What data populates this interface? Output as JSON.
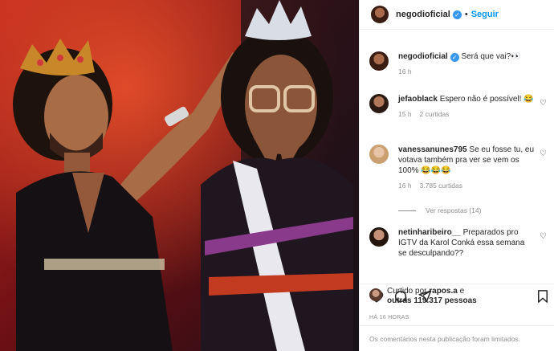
{
  "post": {
    "author": "negodioficial",
    "follow_label": "Seguir",
    "caption_text": "Será que vai?👀",
    "caption_time": "16 h"
  },
  "comments": [
    {
      "user": "jefaoblack",
      "text": "Espero não é possível! 😂",
      "time": "15 h",
      "replies": "2 curtidas"
    },
    {
      "user": "vanessanunes795",
      "text": "Se eu fosse tu, eu votava também pra ver se vem os 100% 😂😂😂",
      "time": "16 h",
      "replies": "3.785 curtidas"
    },
    {
      "user": "netinharibeiro__",
      "text": "Preparados pro IGTV da Karol Conká essa semana se desculpando??",
      "time": "",
      "replies": ""
    }
  ],
  "view_replies_label": "Ver respostas (14)",
  "likes": {
    "prefix": "Curtido por ",
    "user": "rapos.a",
    "suffix": " e",
    "others": "outras 119.317 pessoas"
  },
  "post_time": "HÁ 16 HORAS",
  "comments_limited": "Os comentários nesta publicação foram limitados."
}
